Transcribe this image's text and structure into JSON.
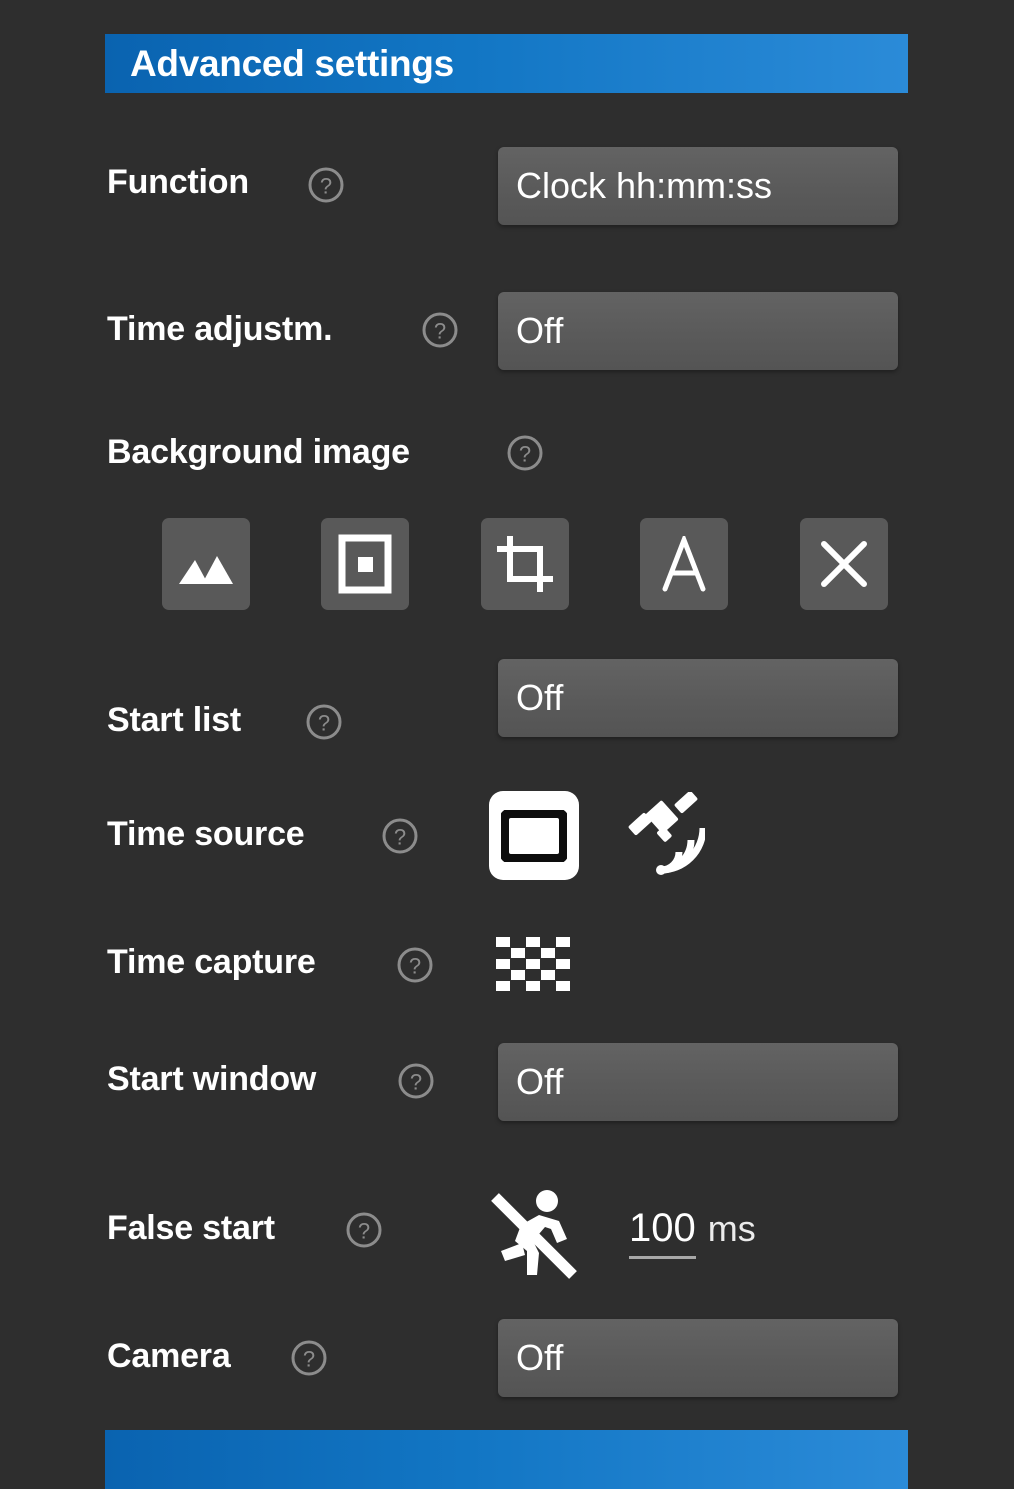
{
  "header": {
    "title": "Advanced settings",
    "accent_left": "#0a63b0",
    "accent_right": "#2b8bd8"
  },
  "colors": {
    "background": "#2e2e2e",
    "field": "#5a5a5a",
    "icon_button": "#595959",
    "text": "#ffffff",
    "help_icon": "#8c8c8c"
  },
  "rows": {
    "function": {
      "label": "Function",
      "help": "?",
      "value": "Clock hh:mm:ss"
    },
    "time_adjustment": {
      "label": "Time adjustm.",
      "help": "?",
      "value": "Off"
    },
    "background_image": {
      "label": "Background image",
      "help": "?",
      "buttons": [
        {
          "name": "gallery-icon",
          "label": "Gallery"
        },
        {
          "name": "frame-icon",
          "label": "Frame"
        },
        {
          "name": "crop-icon",
          "label": "Crop"
        },
        {
          "name": "text-icon",
          "label": "A"
        },
        {
          "name": "close-icon",
          "label": "X"
        }
      ]
    },
    "start_list": {
      "label": "Start list",
      "help": "?",
      "value": "Off"
    },
    "time_source": {
      "label": "Time source",
      "help": "?",
      "options": [
        {
          "name": "internal-clock-icon",
          "label": "Internal",
          "selected": true
        },
        {
          "name": "satellite-icon",
          "label": "GPS",
          "selected": false
        }
      ]
    },
    "time_capture": {
      "label": "Time capture",
      "help": "?",
      "options": [
        {
          "name": "checkered-flag-icon",
          "label": "Finish line",
          "selected": false
        }
      ]
    },
    "start_window": {
      "label": "Start window",
      "help": "?",
      "value": "Off"
    },
    "false_start": {
      "label": "False start",
      "help": "?",
      "icon": "no-running-icon",
      "number": "100",
      "unit": "ms"
    },
    "camera": {
      "label": "Camera",
      "help": "?",
      "value": "Off"
    }
  }
}
